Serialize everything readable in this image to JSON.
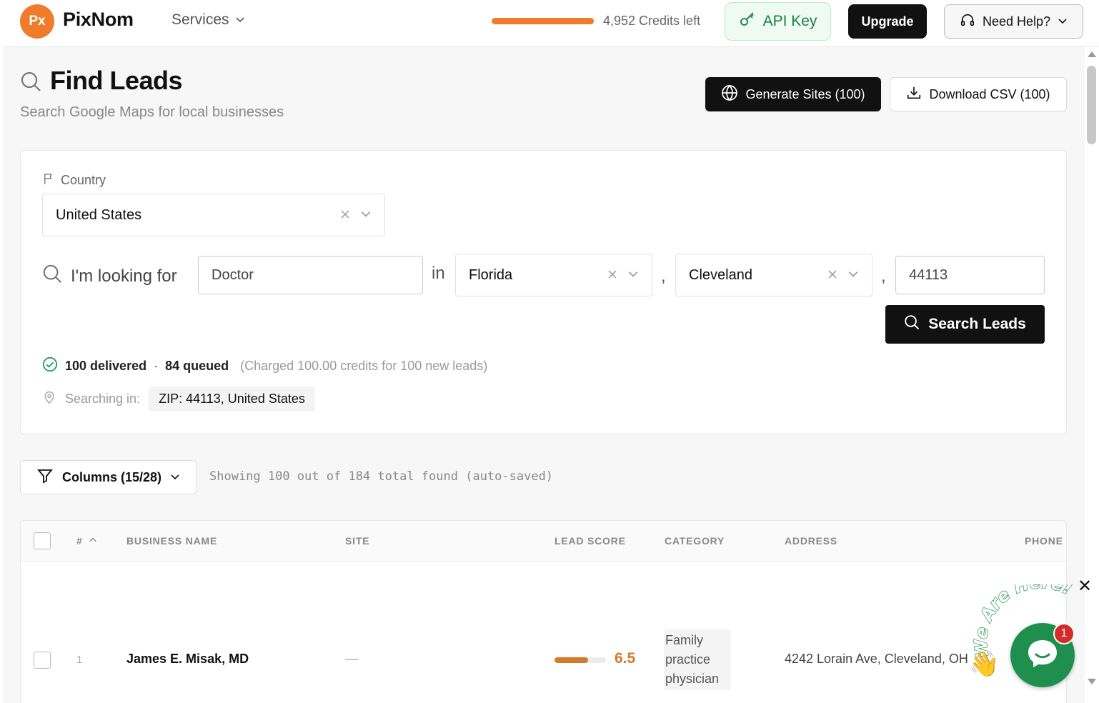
{
  "brand": {
    "logo": "Px",
    "name": "PixNom"
  },
  "nav": {
    "services": "Services"
  },
  "credits": {
    "text": "4,952 Credits left",
    "fraction": 0.99
  },
  "header_buttons": {
    "api_key": "API Key",
    "upgrade": "Upgrade",
    "help": "Need Help?"
  },
  "page": {
    "title": "Find Leads",
    "subtitle": "Search Google Maps for local businesses"
  },
  "actions": {
    "generate": "Generate Sites (100)",
    "download": "Download CSV (100)"
  },
  "search": {
    "country_label": "Country",
    "country_value": "United States",
    "looking_label": "I'm looking for",
    "query_value": "Doctor",
    "in_word": "in",
    "comma": ",",
    "state_value": "Florida",
    "city_value": "Cleveland",
    "zip_value": "44113",
    "search_button": "Search Leads"
  },
  "status": {
    "delivered": "100 delivered",
    "dot": "·",
    "queued": "84 queued",
    "charged": "(Charged 100.00 credits for 100 new leads)",
    "searching_label": "Searching in:",
    "location": "ZIP: 44113, United States"
  },
  "toolbar": {
    "columns": "Columns (15/28)",
    "showing": "Showing 100 out of 184 total found (auto-saved)"
  },
  "table": {
    "headers": {
      "num": "#",
      "business": "BUSINESS NAME",
      "site": "SITE",
      "score": "LEAD SCORE",
      "category": "CATEGORY",
      "address": "ADDRESS",
      "phone": "PHONE"
    },
    "rows": [
      {
        "num": "1",
        "business": "James E. Misak, MD",
        "site": "—",
        "score": "6.5",
        "score_fraction": 0.65,
        "category": "Family practice physician",
        "address": "4242 Lorain Ave, Cleveland, OH"
      }
    ]
  },
  "chat": {
    "badge": "1",
    "arc_text": "We Are Here!",
    "wave": "👋",
    "close": "✕"
  },
  "colors": {
    "accent": "#f07b2b",
    "green": "#1f8f4e",
    "dark": "#111111"
  }
}
